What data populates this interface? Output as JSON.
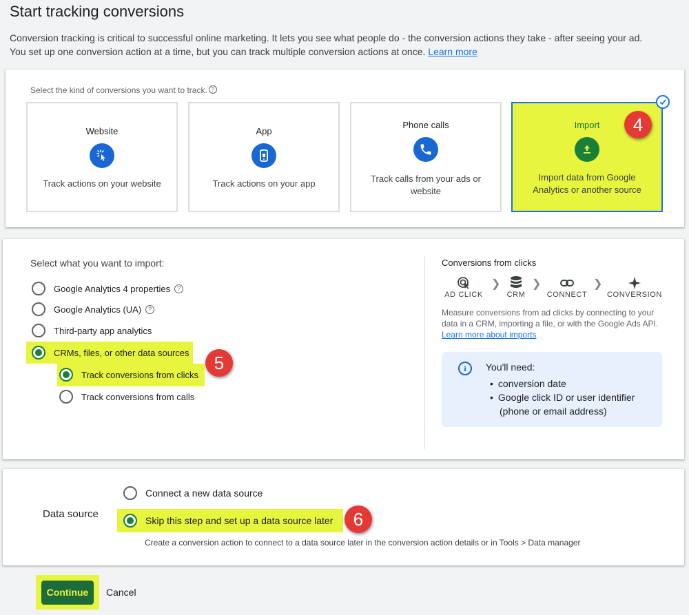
{
  "page": {
    "title": "Start tracking conversions",
    "intro_line1": "Conversion tracking is critical to successful online marketing. It lets you see what people do - the conversion actions they take - after seeing your ad.",
    "intro_line2": "You set up one conversion action at a time, but you can track multiple conversion actions at once.",
    "learn_more": "Learn more"
  },
  "kind": {
    "prompt": "Select the kind of conversions you want to track.",
    "help_icon": "help-circle-icon",
    "tiles": [
      {
        "title": "Website",
        "icon": "cursor-click-icon",
        "desc": "Track actions on your website",
        "selected": false
      },
      {
        "title": "App",
        "icon": "phone-app-icon",
        "desc": "Track actions on your app",
        "selected": false
      },
      {
        "title": "Phone calls",
        "icon": "phone-icon",
        "desc": "Track calls from your ads or website",
        "selected": false
      },
      {
        "title": "Import",
        "icon": "upload-icon",
        "desc": "Import data from Google Analytics or another source",
        "selected": true
      }
    ]
  },
  "badges": {
    "step4": "4",
    "step5": "5",
    "step6": "6"
  },
  "import": {
    "prompt": "Select what you want to import:",
    "options": [
      {
        "label": "Google Analytics 4 properties",
        "selected": false,
        "help": true
      },
      {
        "label": "Google Analytics (UA)",
        "selected": false,
        "help": true
      },
      {
        "label": "Third-party app analytics",
        "selected": false,
        "help": false
      },
      {
        "label": "CRMs, files, or other data sources",
        "selected": true,
        "help": false
      }
    ],
    "sub_options": [
      {
        "label": "Track conversions from clicks",
        "selected": true
      },
      {
        "label": "Track conversions from calls",
        "selected": false
      }
    ]
  },
  "flow": {
    "title": "Conversions from clicks",
    "steps": [
      {
        "label": "AD CLICK",
        "icon": "ad-click-icon"
      },
      {
        "label": "CRM",
        "icon": "database-icon"
      },
      {
        "label": "CONNECT",
        "icon": "link-icon"
      },
      {
        "label": "CONVERSION",
        "icon": "sparkle-icon"
      }
    ],
    "desc": "Measure conversions from ad clicks by connecting to your data in a CRM, importing a file, or with the Google Ads API.",
    "learn_more": "Learn more about imports"
  },
  "need": {
    "title": "You'll need:",
    "item1": "conversion date",
    "item2a": "Google click ID or user identifier",
    "item2b": "(phone or email address)"
  },
  "data_source": {
    "label": "Data source",
    "options": [
      {
        "label": "Connect a new data source",
        "selected": false
      },
      {
        "label": "Skip this step and set up a data source later",
        "selected": true
      }
    ],
    "hint": "Create a conversion action to connect to a data source later in the conversion action details or in Tools > Data manager"
  },
  "footer": {
    "continue": "Continue",
    "cancel": "Cancel"
  },
  "colors": {
    "highlight": "#e8f53f",
    "accent_blue": "#1a73e8",
    "accent_green": "#188038",
    "badge_red": "#e53935"
  }
}
